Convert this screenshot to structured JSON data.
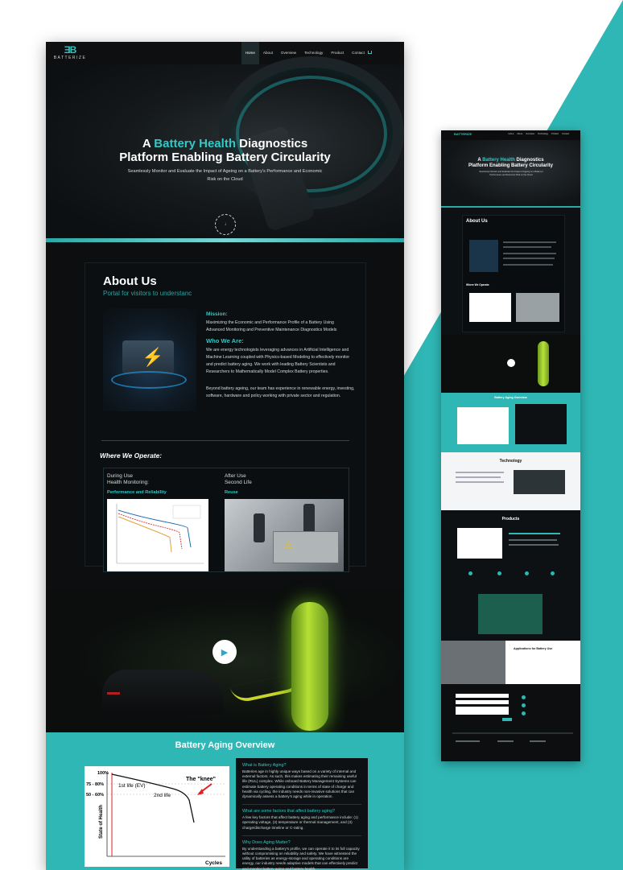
{
  "nav": {
    "logo_text": "BATTERIZE",
    "items": [
      "Home",
      "About",
      "Overview",
      "Technology",
      "Product",
      "Contact"
    ],
    "active": "Home"
  },
  "hero": {
    "title_pre": "A ",
    "title_highlight": "Battery Health",
    "title_post": " Diagnostics",
    "title_line2": "Platform Enabling Battery Circularity",
    "subtitle": "Seamlessly Monitor and Evaluate the Impact of Ageing on a Battery's Performance and Economic Risk on the Cloud"
  },
  "about": {
    "heading": "About Us",
    "tagline": "Portal for visitors to understanc",
    "mission_heading": "Mission:",
    "mission_text": "Maximizing the Economic and Performance Profile of a Battery Using Advanced Monitoring and Preventive Maintenance Diagnostics Models",
    "who_heading": "Who We Are:",
    "who_text": "We are energy technologists leveraging advances in Artificial Intelligence and Machine Learning coupled with Physics-based Modeling to effectively monitor and predict battery aging. We work with leading Battery Scientists and Researchers to Mathematically Model Complex Battery properties.",
    "who_text2": "Beyond battery ageing, our team has experience in renewable energy, investing, software, hardware and policy working with private sector and regulation.",
    "where_heading": "Where We Operate:",
    "col1_title": "During Use\nHealth Monitoring:",
    "col1_tag": "Performance and Reliability",
    "col2_title": "After Use\nSecond Life",
    "col2_tag": "Reuse"
  },
  "aging": {
    "heading": "Battery Aging Overview",
    "q1": "What is Battery Aging?",
    "a1": "Batteries age in highly unique ways based on a variety of internal and external factors. As such, this makes estimating their remaining useful life (RUL) complex. While onboard Battery Management Systems can estimate battery operating conditions in terms of state of charge and health via cycling, the industry needs non-invasive solutions that can dynamically assess a battery's aging while in operation.",
    "q2": "What are some factors that affect battery aging?",
    "a2": "A few key factors that affect battery aging and performance include: (1) operating voltage, (2) temperature or thermal management, and (3) charge/discharge timeline or C-rating.",
    "q3": "Why Does Aging Matter?",
    "a3": "By understanding a battery's profile, we can operate it to its full capacity without compromising on reliability and safety. We have witnessed the utility of batteries as energy-storage and operating conditions are energy, our industry needs adaptive models that can effectively predict and monitor battery aging and battery health."
  },
  "aging_chart": {
    "y_labels": [
      "100%",
      "75 - 80%",
      "50 - 60%"
    ],
    "ylabel": "State of Health",
    "xlabel": "Cycles",
    "label_first": "1st life (EV)",
    "label_second": "2nd life",
    "label_knee": "The \"knee\""
  },
  "mini": {
    "hero_line1_pre": "A ",
    "hero_line1_hl": "Battery Health",
    "hero_line1_post": " Diagnostics",
    "hero_line2": "Platform Enabling Battery Circularity",
    "about": "About Us",
    "where": "Where We Operate:",
    "aging": "Battery Aging Overview",
    "technology": "Technology",
    "products": "Products",
    "applications": "Applications for Battery Use"
  },
  "colors": {
    "accent": "#2fb7b5",
    "dark": "#0c0e10"
  }
}
